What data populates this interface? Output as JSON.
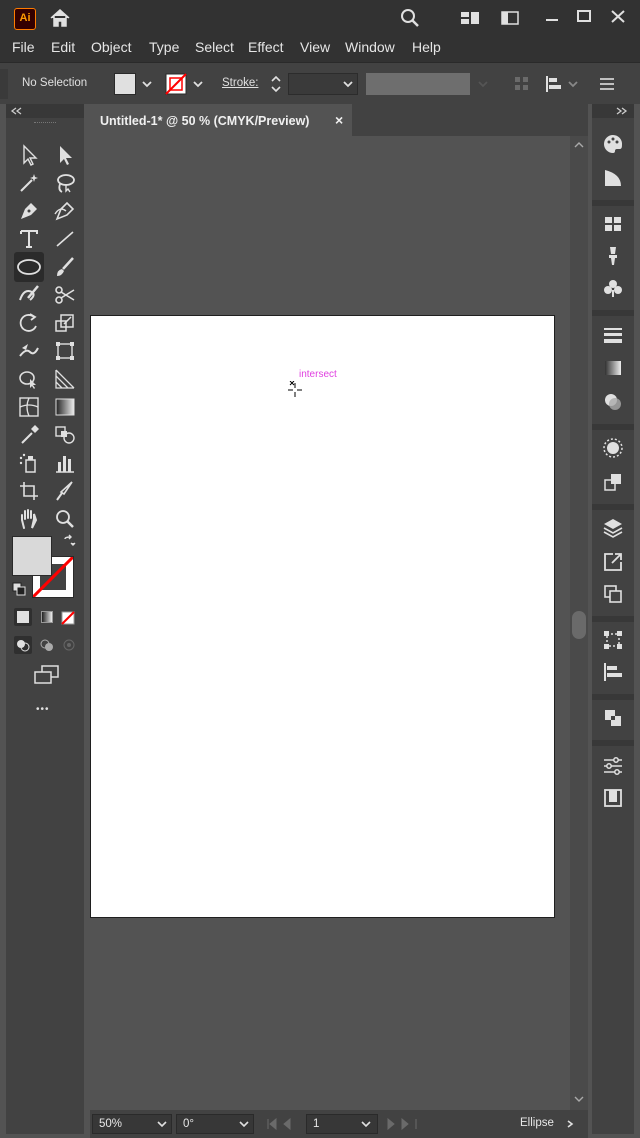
{
  "app": {
    "logo": "Ai"
  },
  "menu": [
    "File",
    "Edit",
    "Object",
    "Type",
    "Select",
    "Effect",
    "View",
    "Window",
    "Help"
  ],
  "control": {
    "selection": "No Selection",
    "stroke_label": "Stroke:"
  },
  "document": {
    "tab_title": "Untitled-1* @ 50 % (CMYK/Preview)",
    "close": "×"
  },
  "canvas": {
    "smart_guide": "intersect"
  },
  "status": {
    "zoom": "50%",
    "rotation": "0°",
    "artboard": "1",
    "tool": "Ellipse"
  },
  "toolbar": {
    "more": "•••"
  },
  "colors": {
    "accent": "#ff7c00",
    "guide": "#e040e0",
    "none_swatch": "#ff0000"
  },
  "icons": [
    "selection-icon",
    "direct-selection-icon",
    "magic-wand-icon",
    "lasso-icon",
    "pen-icon",
    "curvature-icon",
    "type-icon",
    "line-segment-icon",
    "ellipse-icon",
    "paintbrush-icon",
    "shaper-icon",
    "scissors-icon",
    "rotate-icon",
    "scale-icon",
    "warp-icon",
    "free-transform-icon",
    "shape-builder-icon",
    "perspective-grid-icon",
    "mesh-icon",
    "gradient-icon",
    "eyedropper-icon",
    "blend-icon",
    "symbol-sprayer-icon",
    "column-graph-icon",
    "artboard-icon",
    "slice-icon",
    "hand-icon",
    "zoom-icon"
  ]
}
